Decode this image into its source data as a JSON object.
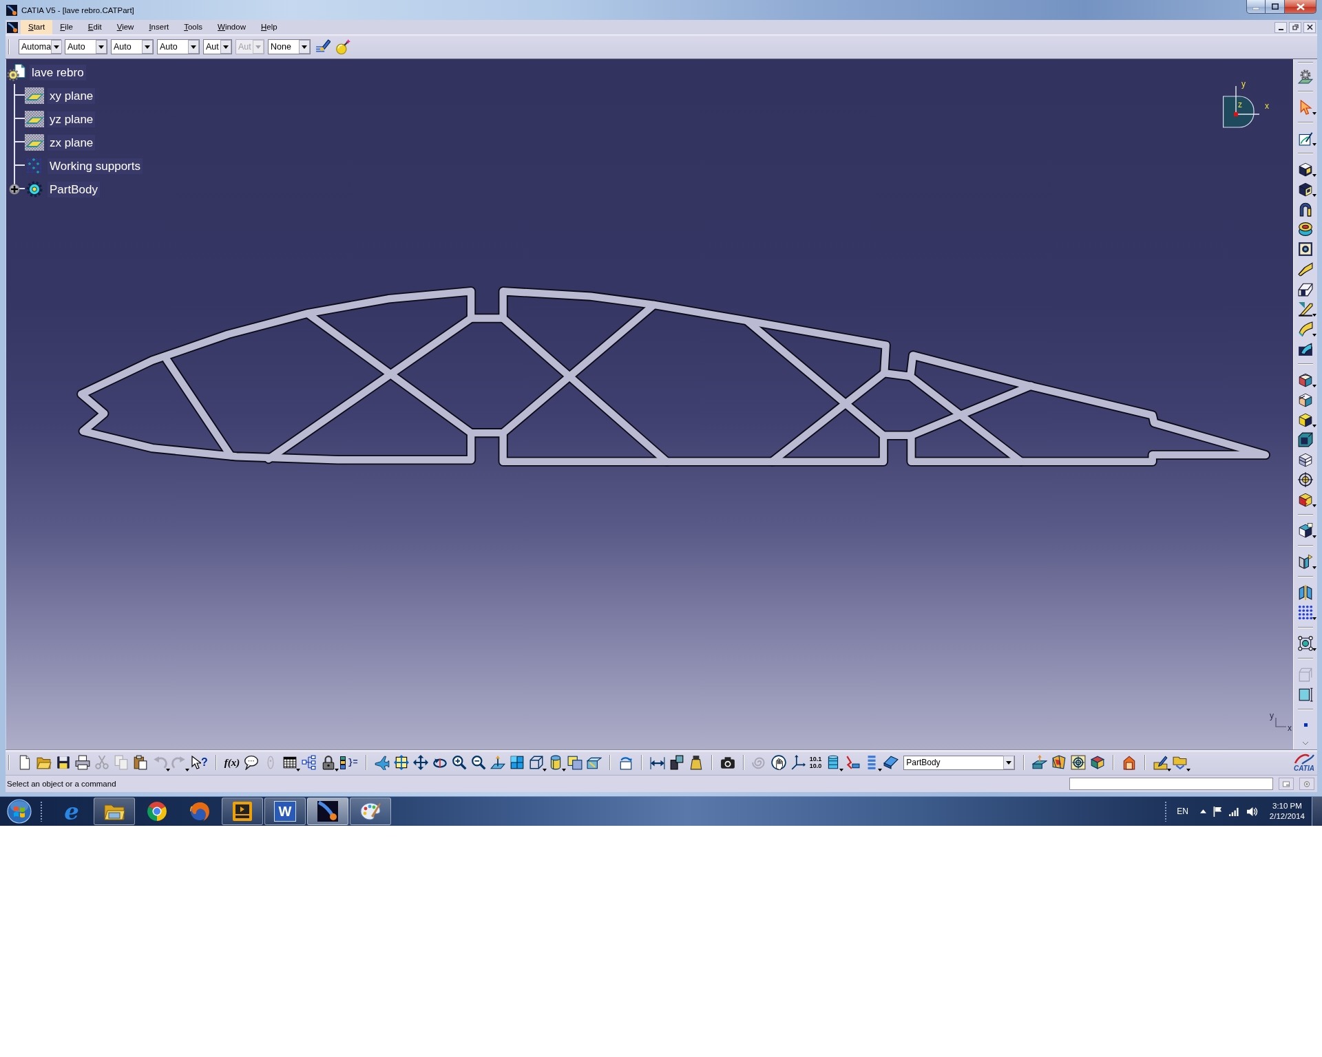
{
  "window": {
    "title": "CATIA V5 - [lave rebro.CATPart]"
  },
  "menu_bar": {
    "items": [
      {
        "label": "Start",
        "selected": true
      },
      {
        "label": "File",
        "selected": false
      },
      {
        "label": "Edit",
        "selected": false
      },
      {
        "label": "View",
        "selected": false
      },
      {
        "label": "Insert",
        "selected": false
      },
      {
        "label": "Tools",
        "selected": false
      },
      {
        "label": "Window",
        "selected": false
      },
      {
        "label": "Help",
        "selected": false
      }
    ]
  },
  "style_toolbar": {
    "combos": [
      {
        "value": "Automa",
        "disabled": false
      },
      {
        "value": "Auto",
        "disabled": false
      },
      {
        "value": "Auto",
        "disabled": false
      },
      {
        "value": "Auto",
        "disabled": false
      },
      {
        "value": "Aut",
        "disabled": false
      },
      {
        "value": "Aut",
        "disabled": true
      },
      {
        "value": "None",
        "disabled": false
      }
    ]
  },
  "specification_tree": {
    "root": {
      "label": "lave rebro",
      "kind": "part",
      "children": [
        {
          "label": "xy plane",
          "kind": "plane"
        },
        {
          "label": "yz plane",
          "kind": "plane"
        },
        {
          "label": "zx plane",
          "kind": "plane"
        },
        {
          "label": "Working supports",
          "kind": "grid"
        },
        {
          "label": "PartBody",
          "kind": "body",
          "expanded": false
        }
      ]
    }
  },
  "compass": {
    "labels": [
      "y",
      "z",
      "x"
    ]
  },
  "corner_axes": {
    "labels": [
      "y",
      "x"
    ]
  },
  "bottom_toolbar": {
    "help_glyph": "?",
    "formula_glyph": "f(x)",
    "parameter_glyph": "}=",
    "units_glyph": [
      "10.1",
      "10.0"
    ],
    "current_body": "PartBody",
    "brand": "CATIA"
  },
  "status_bar": {
    "message": "Select an object or a command"
  },
  "taskbar": {
    "apps": [
      {
        "kind": "eletter",
        "glyph": "e",
        "running": false,
        "selected": false
      },
      {
        "kind": "folder",
        "running": true,
        "selected": false
      },
      {
        "kind": "ringball",
        "running": false,
        "selected": false
      },
      {
        "kind": "foxglobe",
        "running": false,
        "selected": false
      },
      {
        "kind": "player",
        "running": true,
        "selected": false
      },
      {
        "kind": "wtile",
        "glyph": "W",
        "running": true,
        "selected": false
      },
      {
        "kind": "comet",
        "running": true,
        "selected": true
      },
      {
        "kind": "palette",
        "running": true,
        "selected": false
      }
    ],
    "tray": {
      "language": "EN",
      "time": "3:10 PM",
      "date": "2/12/2014"
    }
  }
}
